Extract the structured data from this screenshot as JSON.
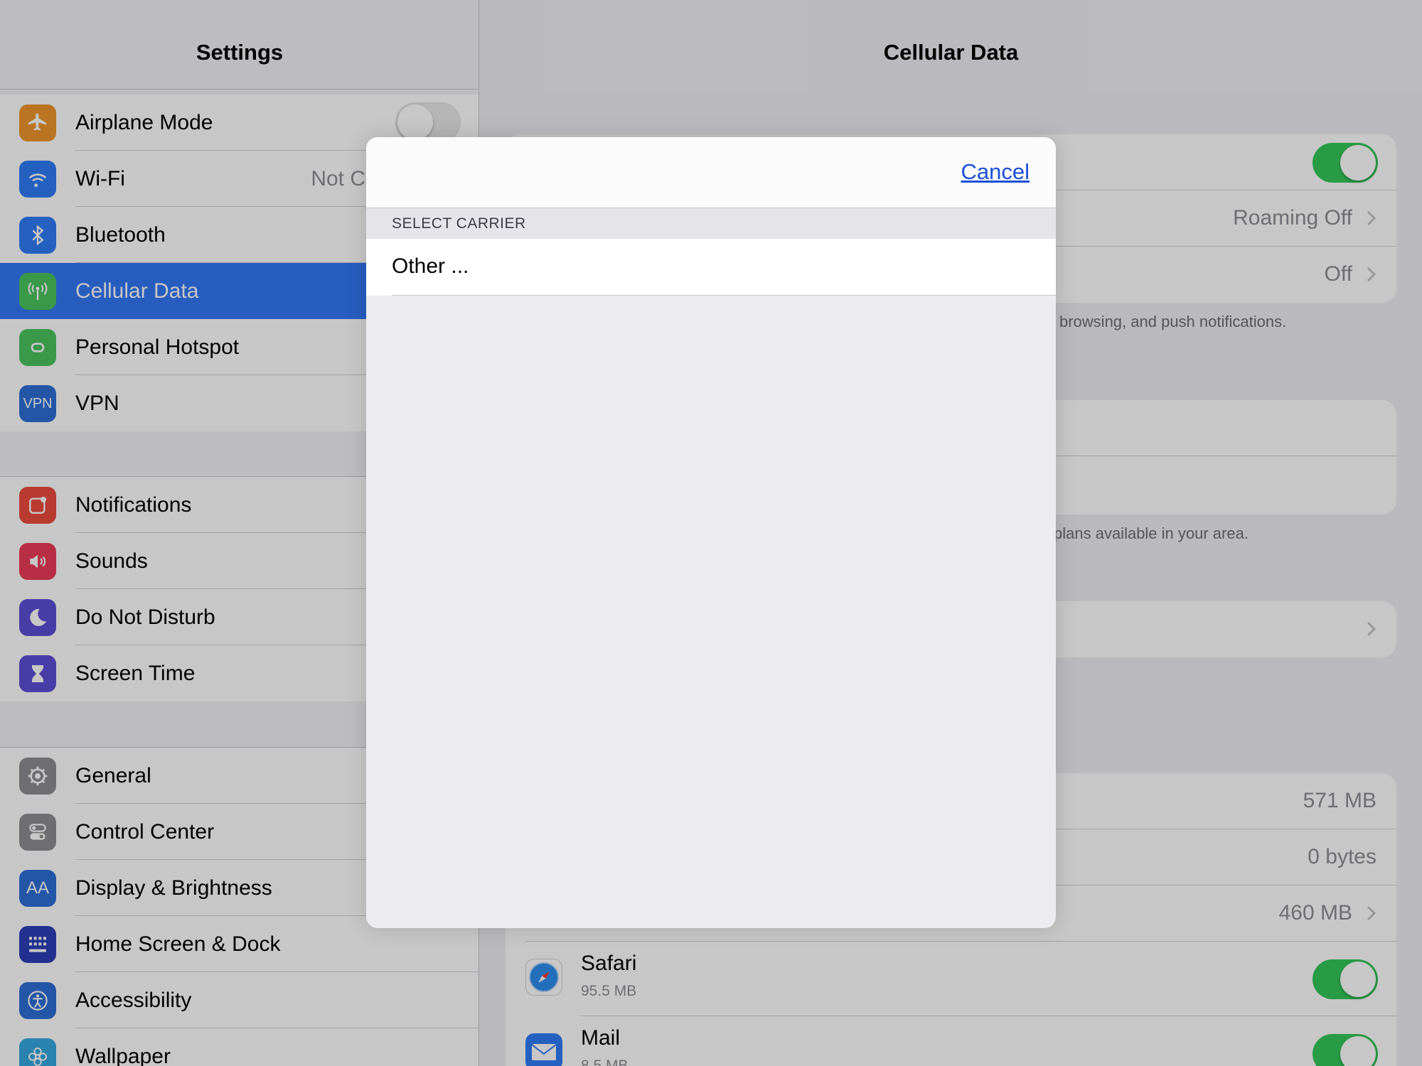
{
  "sidebar": {
    "title": "Settings",
    "groups": [
      [
        {
          "label": "Airplane Mode",
          "icon": "airplane-icon",
          "color": "#f0952b",
          "control": "toggle-off"
        },
        {
          "label": "Wi-Fi",
          "icon": "wifi-icon",
          "color": "#2f7cf6",
          "value": "Not C"
        },
        {
          "label": "Bluetooth",
          "icon": "bluetooth-icon",
          "color": "#2f7cf6"
        },
        {
          "label": "Cellular Data",
          "icon": "antenna-icon",
          "color": "#49c45e",
          "selected": true
        },
        {
          "label": "Personal Hotspot",
          "icon": "hotspot-icon",
          "color": "#49c45e"
        },
        {
          "label": "VPN",
          "icon": "vpn-icon",
          "color": "#2f6fd8",
          "icon_text": "VPN"
        }
      ],
      [
        {
          "label": "Notifications",
          "icon": "notifications-icon",
          "color": "#ec4b3f"
        },
        {
          "label": "Sounds",
          "icon": "speaker-icon",
          "color": "#ec3c58"
        },
        {
          "label": "Do Not Disturb",
          "icon": "moon-icon",
          "color": "#5d4fd6"
        },
        {
          "label": "Screen Time",
          "icon": "hourglass-icon",
          "color": "#5d4fd6"
        }
      ],
      [
        {
          "label": "General",
          "icon": "gear-icon",
          "color": "#8e8e93"
        },
        {
          "label": "Control Center",
          "icon": "switches-icon",
          "color": "#8e8e93"
        },
        {
          "label": "Display & Brightness",
          "icon": "text-size-icon",
          "color": "#2f6fd8",
          "icon_text": "AA"
        },
        {
          "label": "Home Screen & Dock",
          "icon": "grid-icon",
          "color": "#2c3fb8"
        },
        {
          "label": "Accessibility",
          "icon": "accessibility-icon",
          "color": "#2f6fd8"
        },
        {
          "label": "Wallpaper",
          "icon": "flower-icon",
          "color": "#36a8e0"
        }
      ]
    ]
  },
  "detail": {
    "title": "Cellular Data",
    "roaming_value": "Roaming Off",
    "off_value": "Off",
    "footer1": "browsing, and push notifications.",
    "footer2": "plans available in your area.",
    "usage": [
      {
        "value": "571 MB"
      },
      {
        "value": "0 bytes"
      },
      {
        "value": "460 MB"
      }
    ],
    "apps": [
      {
        "name": "Safari",
        "size": "95.5 MB",
        "icon": "safari-icon"
      },
      {
        "name": "Mail",
        "size": "8.5 MB",
        "icon": "mail-icon"
      }
    ]
  },
  "modal": {
    "cancel_label": "Cancel",
    "section_header": "SELECT CARRIER",
    "option_label": "Other ..."
  },
  "colors": {
    "accent": "#3478f6",
    "toggle_on": "#34c759",
    "link": "#1a4fd6"
  }
}
